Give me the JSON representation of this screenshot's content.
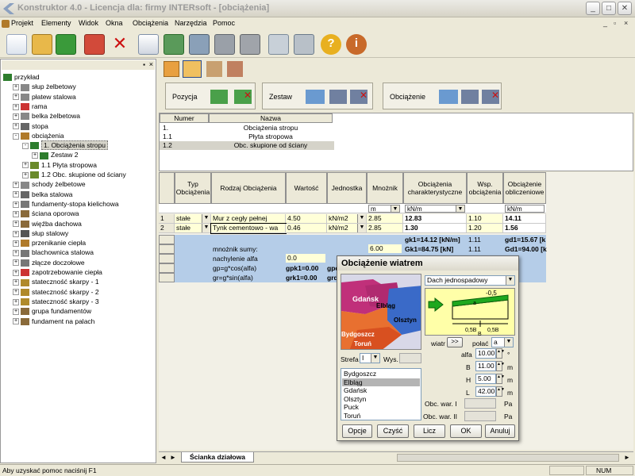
{
  "window": {
    "title": "Konstruktor 4.0 - Licencja dla: firmy INTERsoft - [obciążenia]"
  },
  "menu": [
    "Projekt",
    "Elementy",
    "Widok",
    "Okna",
    "Obciążenia",
    "Narzędzia",
    "Pomoc"
  ],
  "tree": [
    {
      "label": "przykład",
      "level": 0,
      "exp": "",
      "icon": "#2d7d2d"
    },
    {
      "label": "słup żelbetowy",
      "level": 1,
      "exp": "+",
      "icon": "#888"
    },
    {
      "label": "płatew stalowa",
      "level": 1,
      "exp": "+",
      "icon": "#888"
    },
    {
      "label": "rama",
      "level": 1,
      "exp": "+",
      "icon": "#cc3333"
    },
    {
      "label": "belka żelbetowa",
      "level": 1,
      "exp": "+",
      "icon": "#888"
    },
    {
      "label": "stopa",
      "level": 1,
      "exp": "+",
      "icon": "#666"
    },
    {
      "label": "obciążenia",
      "level": 1,
      "exp": "-",
      "icon": "#b07a2a"
    },
    {
      "label": "1. Obciążenia stropu",
      "level": 2,
      "exp": "-",
      "icon": "#2d7d2d",
      "selected": true
    },
    {
      "label": "Zestaw 2",
      "level": 3,
      "exp": "+",
      "icon": "#2d7d2d"
    },
    {
      "label": "1.1 Płyta stropowa",
      "level": 2,
      "exp": "+",
      "icon": "#6a8a2a"
    },
    {
      "label": "1.2 Obc. skupione od ściany",
      "level": 2,
      "exp": "+",
      "icon": "#6a8a2a"
    },
    {
      "label": "schody żelbetowe",
      "level": 1,
      "exp": "+",
      "icon": "#888"
    },
    {
      "label": "belka stalowa",
      "level": 1,
      "exp": "+",
      "icon": "#666"
    },
    {
      "label": "fundamenty-stopa kielichowa",
      "level": 1,
      "exp": "+",
      "icon": "#777"
    },
    {
      "label": "ściana oporowa",
      "level": 1,
      "exp": "+",
      "icon": "#8a6a3a"
    },
    {
      "label": "więźba dachowa",
      "level": 1,
      "exp": "+",
      "icon": "#8a6a3a"
    },
    {
      "label": "słup stalowy",
      "level": 1,
      "exp": "+",
      "icon": "#555"
    },
    {
      "label": "przenikanie ciepła",
      "level": 1,
      "exp": "+",
      "icon": "#b07a2a"
    },
    {
      "label": "blachownica stalowa",
      "level": 1,
      "exp": "+",
      "icon": "#777"
    },
    {
      "label": "złącze doczołowe",
      "level": 1,
      "exp": "+",
      "icon": "#777"
    },
    {
      "label": "zapotrzebowanie ciepła",
      "level": 1,
      "exp": "+",
      "icon": "#cc3333"
    },
    {
      "label": "stateczność skarpy - 1",
      "level": 1,
      "exp": "+",
      "icon": "#b08a2a"
    },
    {
      "label": "stateczność skarpy - 2",
      "level": 1,
      "exp": "+",
      "icon": "#b08a2a"
    },
    {
      "label": "stateczność skarpy - 3",
      "level": 1,
      "exp": "+",
      "icon": "#b08a2a"
    },
    {
      "label": "grupa fundamentów",
      "level": 1,
      "exp": "+",
      "icon": "#8a6a3a"
    },
    {
      "label": "fundament na palach",
      "level": 1,
      "exp": "+",
      "icon": "#8a6a3a"
    }
  ],
  "groups": {
    "pozycja": "Pozycja",
    "zestaw": "Zestaw",
    "obciazenie": "Obciążenie"
  },
  "positions": {
    "headers": [
      "Numer",
      "Nazwa"
    ],
    "rows": [
      [
        "1.",
        "Obciążenia stropu"
      ],
      [
        "1.1",
        "Płyta stropowa"
      ],
      [
        "1.2",
        "Obc. skupione od ściany"
      ]
    ]
  },
  "loads": {
    "headers": [
      "Typ Obciążenia",
      "Rodzaj Obciążenia",
      "Wartość",
      "Jednostka",
      "Mnożnik",
      "Obciążenia charakterystyczne",
      "Wsp. obciążenia",
      "Obciążenie obliczeniowe"
    ],
    "unit_row": {
      "mn": "m",
      "char": "kN/m",
      "calc": "kN/m"
    },
    "rows": [
      {
        "n": "1",
        "typ": "stałe",
        "rodzaj": "Mur z cegły pełnej",
        "wart": "4.50",
        "jed": "kN/m2",
        "mn": "2.85",
        "char": "12.83",
        "wsp": "1.10",
        "obl": "14.11"
      },
      {
        "n": "2",
        "typ": "stałe",
        "rodzaj": "Tynk cementowo - wa",
        "wart": "0.46",
        "jed": "kN/m2",
        "mn": "2.85",
        "char": "1.30",
        "wsp": "1.20",
        "obl": "1.56"
      }
    ],
    "sum1": {
      "char": "gk1=14.12 [kN/m]",
      "wsp": "1.11",
      "obl": "gd1=15.67 [k"
    },
    "sum2": {
      "label": "mnożnik sumy:",
      "mn": "6.00",
      "char": "Gk1=84.75 [kN]",
      "wsp": "1.11",
      "obl": "Gd1=94.00 [k"
    },
    "alfa": {
      "label": "nachylenie alfa",
      "val": "0.0"
    },
    "gp": {
      "label": "gp=g*cos(alfa)",
      "val": "gpk1=0.00",
      "tail": "gpd"
    },
    "gr": {
      "label": "gr=g*sin(alfa)",
      "val": "grk1=0.00",
      "tail": "grd"
    }
  },
  "tab": "Ścianka działowa",
  "dialog": {
    "title": "Obciążenie wiatrem",
    "roof_type": "Dach jednospadowy",
    "map_cities": [
      "Gdańsk",
      "Elbląg",
      "Olsztyn",
      "Bydgoszcz",
      "Toruń"
    ],
    "diagram": {
      "coef": "-0,5",
      "a": "a",
      "b1": "0,5B",
      "b2": "0,5B",
      "B": "B"
    },
    "wiatr_label": "wiatr",
    "wiatr_btn": ">>",
    "polac_label": "połać",
    "polac_val": "a",
    "strefa_label": "Strefa",
    "strefa_val": "I",
    "wys_label": "Wys.",
    "list": [
      "Bydgoszcz",
      "Elbląg",
      "Gdańsk",
      "Olsztyn",
      "Puck",
      "Toruń"
    ],
    "selected_city": "Elbląg",
    "params": [
      {
        "label": "alfa",
        "val": "10.00",
        "unit": "°"
      },
      {
        "label": "B",
        "val": "11.00",
        "unit": "m"
      },
      {
        "label": "H",
        "val": "5.00",
        "unit": "m"
      },
      {
        "label": "L",
        "val": "42.00",
        "unit": "m"
      }
    ],
    "obc1": "Obc. war. I",
    "obc2": "Obc. war. II",
    "pa": "Pa",
    "buttons": [
      "Opcje",
      "Czyść",
      "Licz",
      "OK",
      "Anuluj"
    ]
  },
  "status": {
    "help": "Aby uzyskać pomoc naciśnij F1",
    "num": "NUM"
  }
}
